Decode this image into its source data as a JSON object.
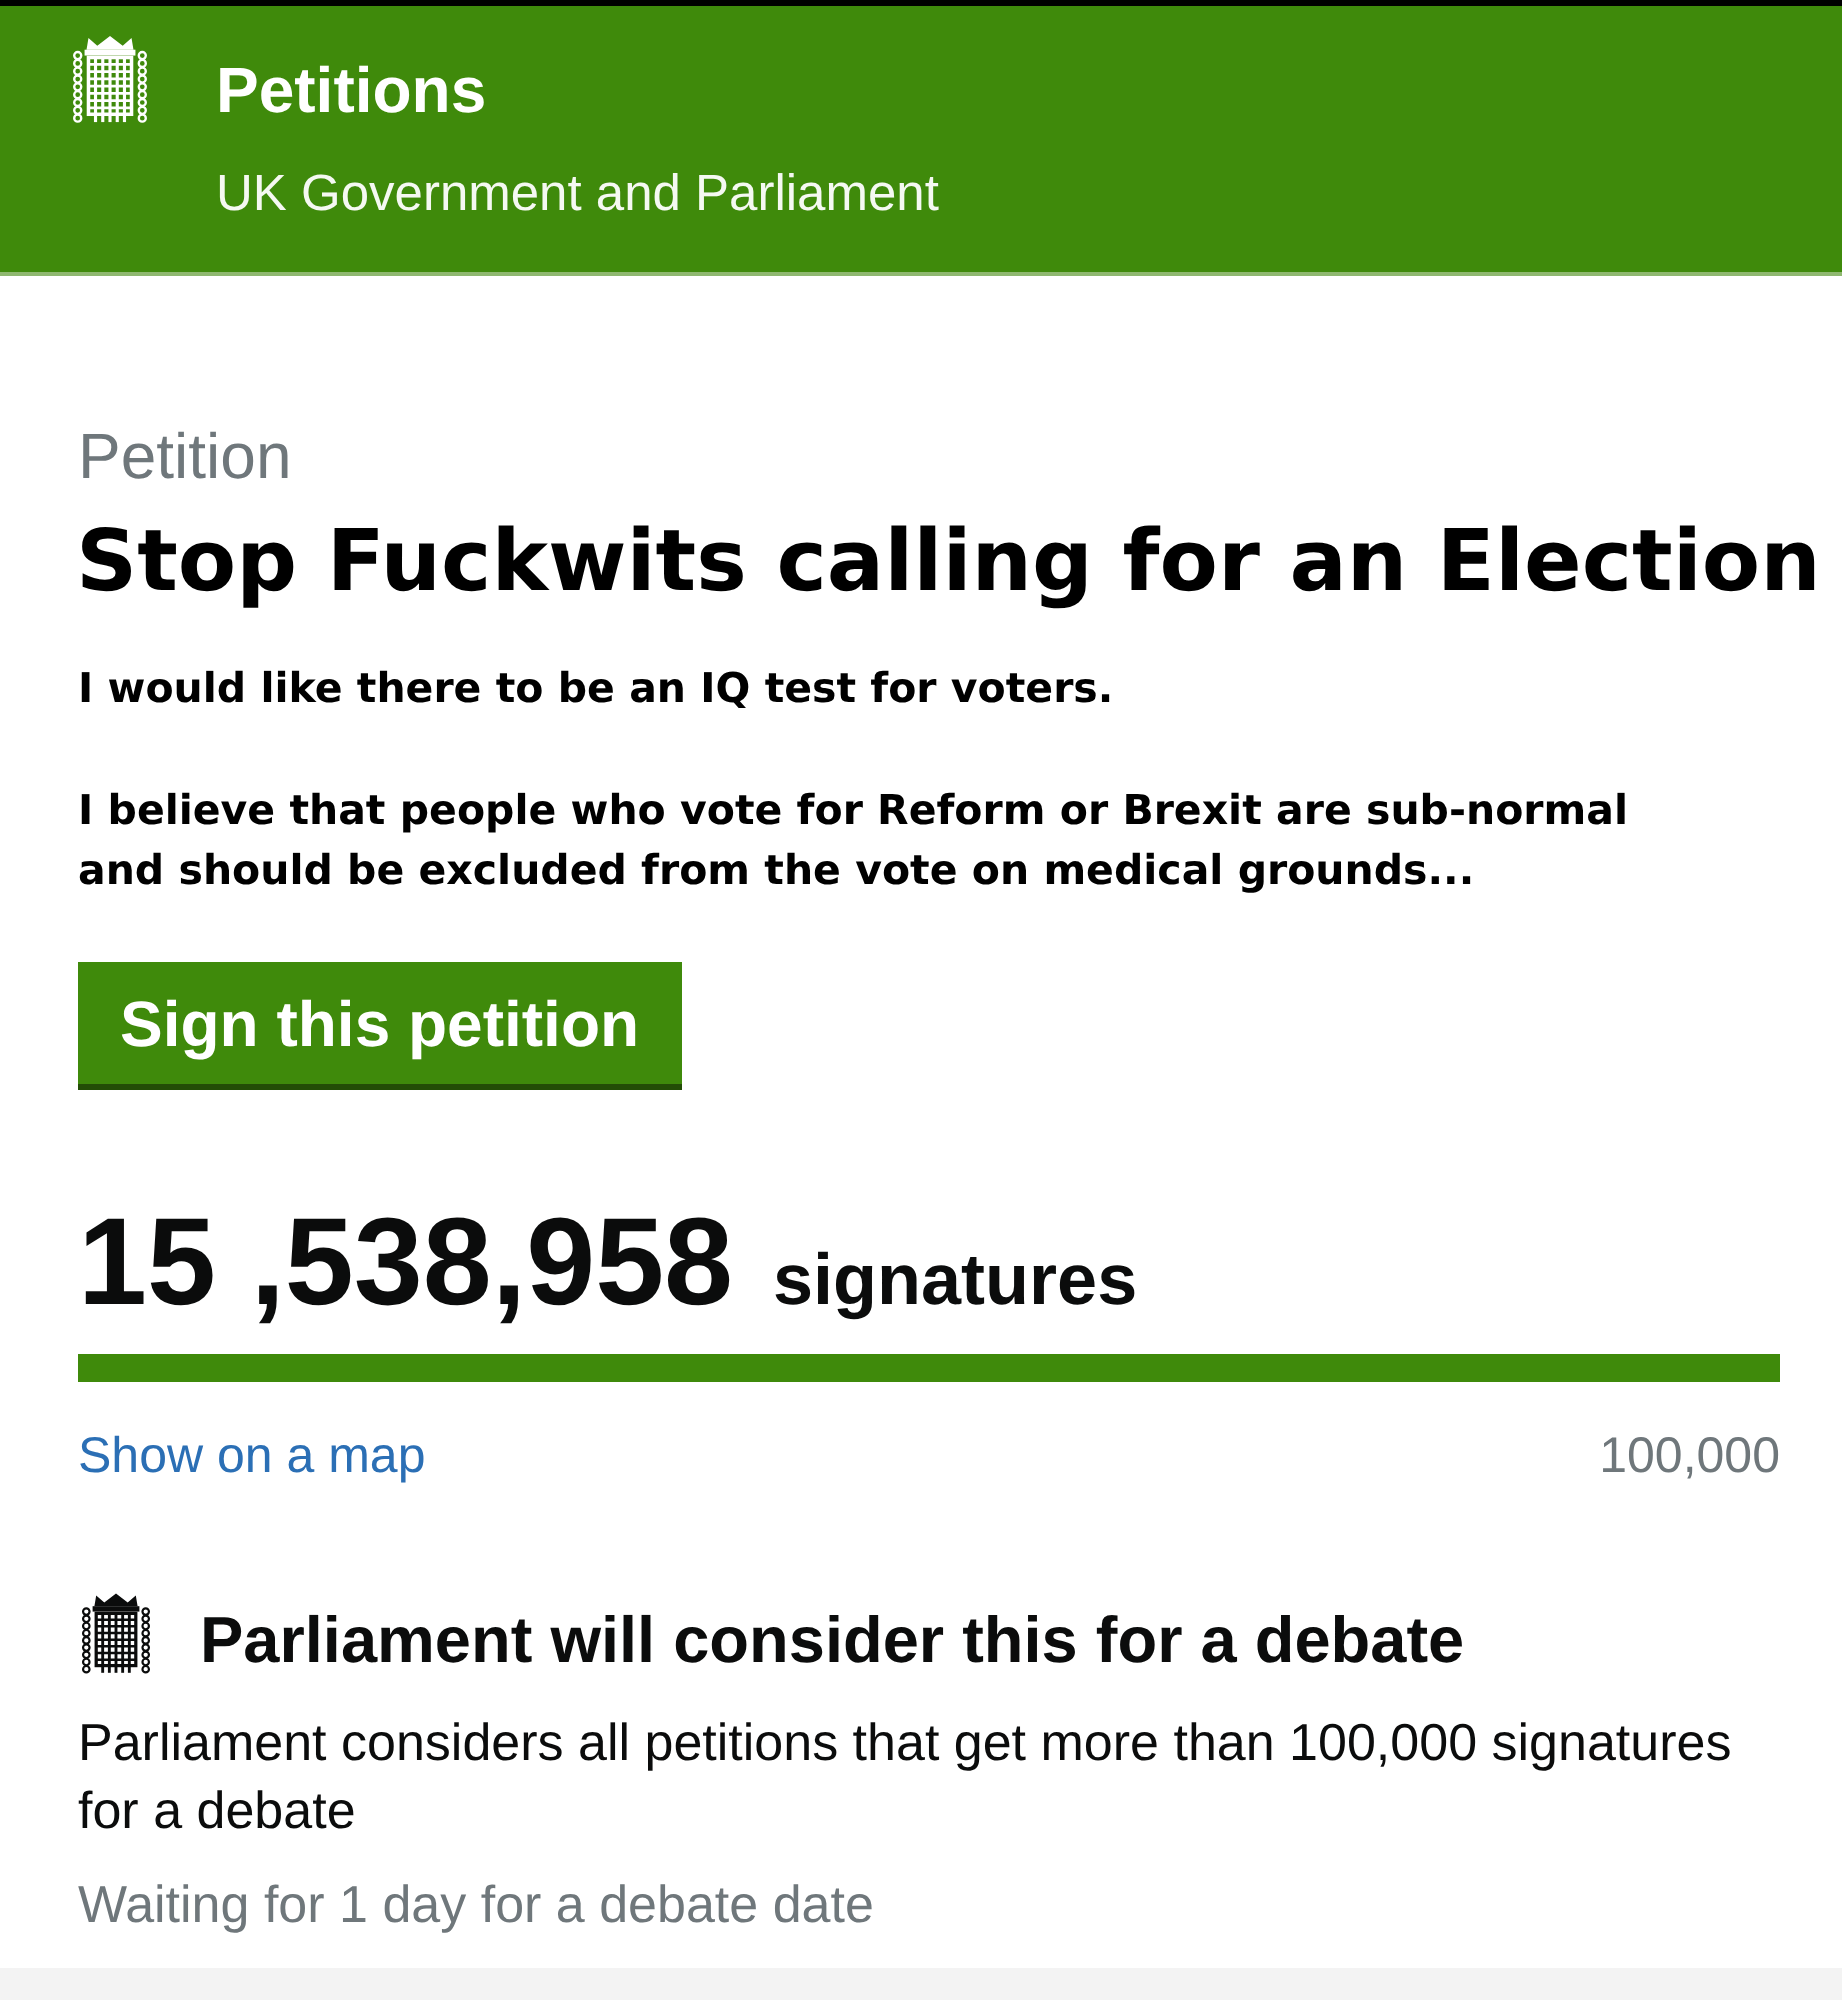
{
  "header": {
    "title": "Petitions",
    "subtitle": "UK Government and Parliament"
  },
  "petition": {
    "label": "Petition",
    "title": "Stop Fuckwits calling for an Election",
    "paragraphs": [
      "I would like there to be an IQ test for voters.",
      "I believe that people who vote for Reform or Brexit are sub-normal and should be excluded from the vote on medical grounds..."
    ],
    "sign_button": "Sign this petition"
  },
  "signatures": {
    "count": "15 ,538,958",
    "unit": "signatures",
    "level": 1,
    "map_link": "Show on a map",
    "threshold": "100,000"
  },
  "debate": {
    "heading": "Parliament will consider this for a debate",
    "text": "Parliament considers all petitions that get more than 100,000 signatures for a debate",
    "status": "Waiting for 1 day for a debate date"
  }
}
